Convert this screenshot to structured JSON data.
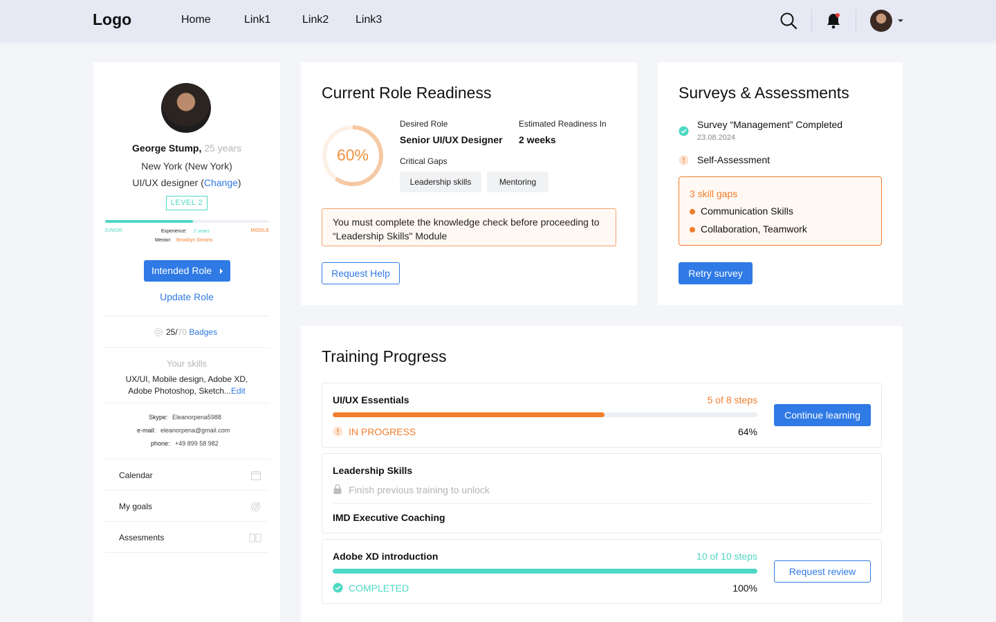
{
  "header": {
    "logo": "Logo",
    "nav": [
      "Home",
      "Link1",
      "Link2",
      "Link3"
    ]
  },
  "profile": {
    "name": "George Stump,",
    "age": "25 years",
    "location": "New York (New York)",
    "role_prefix": "UI/UX designer (",
    "role_change": "Change",
    "role_suffix": ")",
    "level": "LEVEL 2",
    "level_progress_pct": 54,
    "level_from": "JUNIOR",
    "level_to": "MIDDLE",
    "experience_label": "Experience:",
    "experience_value": "2 years",
    "mentor_label": "Mentor:",
    "mentor_value": "Brooklyn Simons",
    "intended_role_button": "Intended Role",
    "update_role_link": "Update Role",
    "badges_count": "25/",
    "badges_total": "70",
    "badges_label": "Badges",
    "skills_title": "Your skills",
    "skills_line1": "UX/UI, Mobile design, Adobe XD,",
    "skills_line2": "Adobe Photoshop, Sketch...",
    "skills_edit": "Edit",
    "skype_label": "Skype:",
    "skype_value": "Eleanorpena5988",
    "email_label": "e-mail:",
    "email_value": "eleanorpena@gmail.com",
    "phone_label": "phone:",
    "phone_value": "+49 899 58 982",
    "menu": [
      "Calendar",
      "My goals",
      "Assesments"
    ]
  },
  "readiness": {
    "title": "Current Role Readiness",
    "percent_label": "60%",
    "percent": 60,
    "desired_role_label": "Desired Role",
    "desired_role": "Senior UI/UX Designer",
    "estimated_label": "Estimated Readiness In",
    "estimated_value": "2 weeks",
    "critical_gaps_label": "Critical Gaps",
    "gaps": [
      "Leadership skills",
      "Mentoring"
    ],
    "warning_line1": "You must complete the knowledge check before proceeding to",
    "warning_line2": "“Leadership Skills\" Module",
    "request_help": "Request Help"
  },
  "surveys": {
    "title": "Surveys & Assessments",
    "item1": "Survey “Management” Completed",
    "item1_date": "23.08.2024",
    "item2": "Self-Assessment",
    "gaps_title": "3 skill gaps",
    "gaps": [
      "Communication Skills",
      "Collaboration, Teamwork"
    ],
    "retry": "Retry survey"
  },
  "training": {
    "title": "Training Progress",
    "items": [
      {
        "title": "UI/UX Essentials",
        "steps": "5 of 8 steps",
        "status": "IN PROGRESS",
        "percent_label": "64%",
        "progress": 0.64,
        "action": "Continue learning"
      },
      {
        "title": "Leadership Skills",
        "locked_text": "Finish previous training to unlock",
        "sub_title": "IMD Executive Coaching"
      },
      {
        "title": "Adobe XD introduction",
        "steps": "10 of 10 steps",
        "status": "COMPLETED",
        "percent_label": "100%",
        "progress": 1.0,
        "action": "Request review"
      }
    ]
  },
  "colors": {
    "accent": "#2f7ae5",
    "orange": "#f07e2e",
    "teal": "#4fd8c4"
  }
}
